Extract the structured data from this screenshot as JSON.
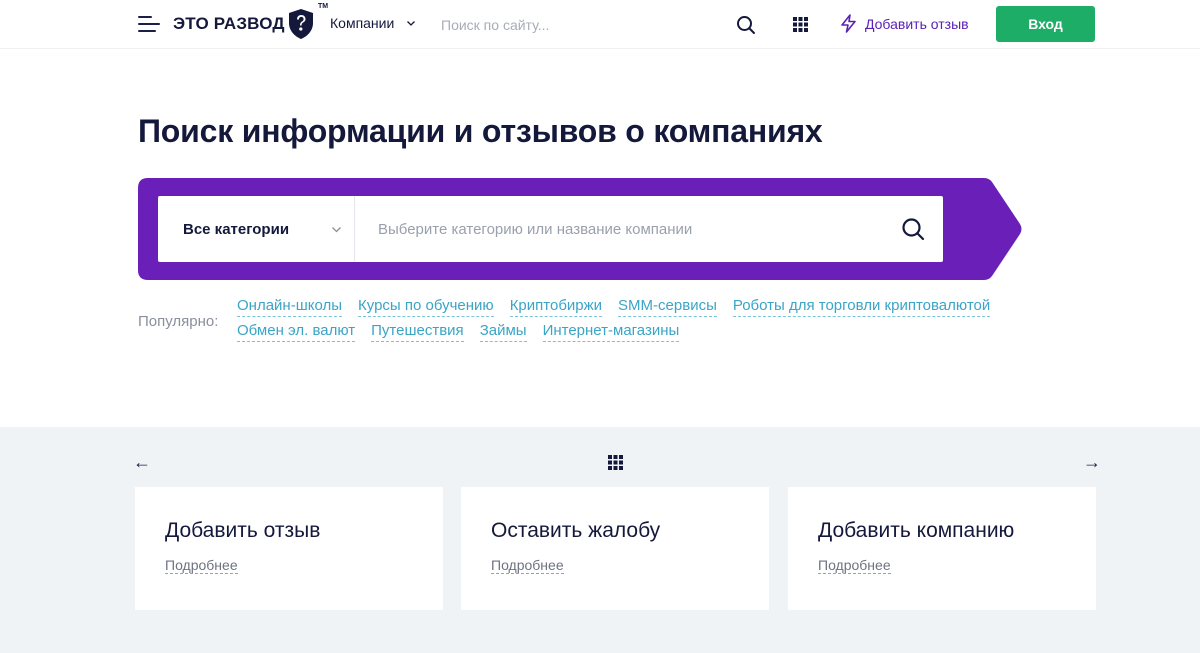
{
  "header": {
    "logo_text": "ЭТО РАЗВОД",
    "logo_tm": "TM",
    "companies_label": "Компании",
    "search_placeholder": "Поиск по сайту...",
    "add_review_label": "Добавить отзыв",
    "login_label": "Вход"
  },
  "hero": {
    "title": "Поиск информации и отзывов о компаниях",
    "category_select": "Все категории",
    "search_placeholder": "Выберите категорию или название компании",
    "popular_label": "Популярно:",
    "popular_row1": [
      "Онлайн-школы",
      "Курсы по обучению",
      "Криптобиржи",
      "SMM-сервисы",
      "Роботы для торговли криптовалютой"
    ],
    "popular_row2": [
      "Обмен эл. валют",
      "Путешествия",
      "Займы",
      "Интернет-магазины"
    ]
  },
  "cards": [
    {
      "title": "Добавить отзыв",
      "more": "Подробнее"
    },
    {
      "title": "Оставить жалобу",
      "more": "Подробнее"
    },
    {
      "title": "Добавить компанию",
      "more": "Подробнее"
    }
  ],
  "colors": {
    "brand_purple": "#6a1fb8",
    "accent_green": "#1ead67",
    "link_blue": "#3aa5c6",
    "dark_text": "#14193c",
    "lower_bg": "#eff3f5"
  },
  "icons": {
    "menu": "burger-icon",
    "logo": "shield-question-icon",
    "search": "search-icon",
    "apps": "grid-icon",
    "add_review": "lightning-icon",
    "prev": "arrow-left-icon",
    "next": "arrow-right-icon"
  }
}
